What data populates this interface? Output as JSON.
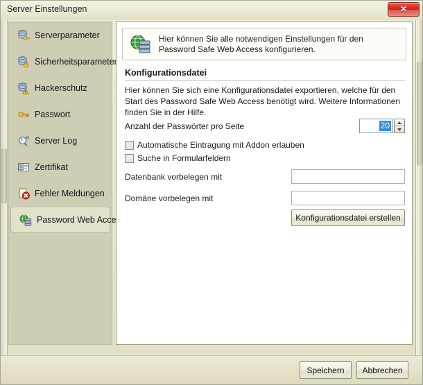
{
  "window": {
    "title": "Server Einstellungen",
    "close_label": "✕",
    "close_icon": "close-icon"
  },
  "sidebar": {
    "items": [
      {
        "label": "Serverparameter",
        "icon": "database-key-icon",
        "selected": false
      },
      {
        "label": "Sicherheitsparameter",
        "icon": "database-lock-icon",
        "selected": false
      },
      {
        "label": "Hackerschutz",
        "icon": "database-warning-icon",
        "selected": false
      },
      {
        "label": "Passwort",
        "icon": "key-icon",
        "selected": false
      },
      {
        "label": "Server Log",
        "icon": "log-monitor-icon",
        "selected": false
      },
      {
        "label": "Zertifikat",
        "icon": "certificate-icon",
        "selected": false
      },
      {
        "label": "Fehler Meldungen",
        "icon": "error-icon",
        "selected": false
      },
      {
        "label": "Password Web Access",
        "icon": "globe-server-icon",
        "selected": true
      }
    ]
  },
  "header": {
    "icon": "globe-server-icon",
    "text": "Hier können Sie alle notwendigen Einstellungen für den Password Safe Web Access konfigurieren."
  },
  "section": {
    "title": "Konfigurationsdatei",
    "description": "Hier können Sie sich eine Konfigurationsdatei exportieren, welche für den Start des Password Safe Web Access benötigt wird. Weitere Informationen finden Sie in der Hilfe."
  },
  "form": {
    "passwords_per_page": {
      "label": "Anzahl der Passwörter pro Seite",
      "value": "20"
    },
    "checkboxes": [
      {
        "label": "Automatische Eintragung mit Addon erlauben",
        "checked": false
      },
      {
        "label": "Suche in Formularfeldern",
        "checked": false
      }
    ],
    "fields": [
      {
        "label": "Datenbank vorbelegen mit",
        "value": "",
        "placeholder": ""
      },
      {
        "label": "Domäne vorbelegen mit",
        "value": "",
        "placeholder": ""
      }
    ],
    "create_button": "Konfigurationsdatei erstellen"
  },
  "footer": {
    "save": "Speichern",
    "cancel": "Abbrechen"
  },
  "colors": {
    "window_background": "#e6e4cc",
    "sidebar_background": "#cfcdb4",
    "selected_item": "#e3e1cb",
    "content_background": "#ffffff",
    "close_button": "#c32418",
    "selection_highlight": "#3a8ad8"
  }
}
